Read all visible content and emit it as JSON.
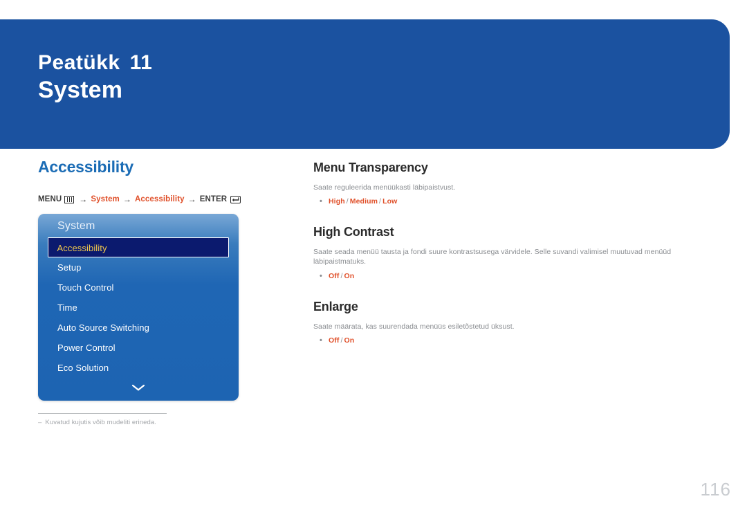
{
  "banner": {
    "chapter_label": "Peatükk",
    "chapter_number": "11",
    "title": "System"
  },
  "left": {
    "section_title": "Accessibility",
    "breadcrumb": {
      "menu_label": "MENU",
      "menu_icon": "menu-bars-icon",
      "arrow": "→",
      "crumb1": "System",
      "crumb2": "Accessibility",
      "enter_label": "ENTER",
      "enter_icon": "enter-return-icon"
    },
    "osd": {
      "header": "System",
      "items": [
        {
          "label": "Accessibility",
          "selected": true
        },
        {
          "label": "Setup",
          "selected": false
        },
        {
          "label": "Touch Control",
          "selected": false
        },
        {
          "label": "Time",
          "selected": false
        },
        {
          "label": "Auto Source Switching",
          "selected": false
        },
        {
          "label": "Power Control",
          "selected": false
        },
        {
          "label": "Eco Solution",
          "selected": false
        }
      ],
      "scroll_icon": "chevron-down-icon"
    },
    "footnote": {
      "dash": "–",
      "text": "Kuvatud kujutis võib mudeliti erineda."
    }
  },
  "right": {
    "entries": [
      {
        "title": "Menu Transparency",
        "description": "Saate reguleerida menüükasti läbipaistvust.",
        "bullet": "•",
        "options": [
          "High",
          "Medium",
          "Low"
        ],
        "separator": "/"
      },
      {
        "title": "High Contrast",
        "description": "Saate seada menüü tausta ja fondi suure kontrastsusega värvidele. Selle suvandi valimisel muutuvad menüüd läbipaistmatuks.",
        "bullet": "•",
        "options": [
          "Off",
          "On"
        ],
        "separator": "/"
      },
      {
        "title": "Enlarge",
        "description": "Saate määrata, kas suurendada menüüs esiletõstetud üksust.",
        "bullet": "•",
        "options": [
          "Off",
          "On"
        ],
        "separator": "/"
      }
    ]
  },
  "page_number": "116",
  "colors": {
    "banner_blue": "#1b52a0",
    "heading_blue": "#1b6cb5",
    "accent_orange": "#e0502a",
    "osd_selected_text": "#f2c94c",
    "osd_selected_bg": "#0b1a6e"
  }
}
